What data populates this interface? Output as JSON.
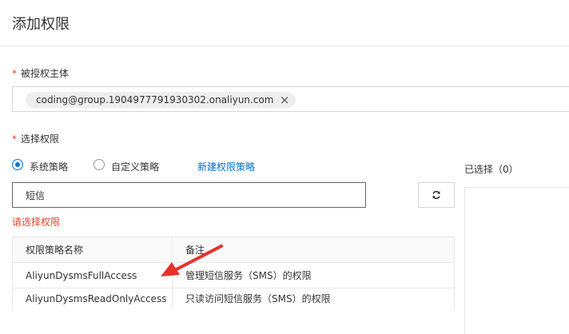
{
  "header": {
    "title": "添加权限"
  },
  "principal": {
    "required_mark": "*",
    "label": "被授权主体",
    "tag_text": "coding@group.1904977791930302.onaliyun.com"
  },
  "permissions": {
    "required_mark": "*",
    "label": "选择权限",
    "radio_system": "系统策略",
    "radio_custom": "自定义策略",
    "selected_radio": "系统策略",
    "new_policy_link": "新建权限策略",
    "search_value": "短信",
    "error": "请选择权限"
  },
  "table": {
    "headers": [
      "权限策略名称",
      "备注"
    ],
    "rows": [
      [
        "AliyunDysmsFullAccess",
        "管理短信服务（SMS）的权限"
      ],
      [
        "AliyunDysmsReadOnlyAccess",
        "只读访问短信服务（SMS）的权限"
      ]
    ]
  },
  "selected": {
    "title": "已选择（0）"
  },
  "colors": {
    "accent": "#0073e6",
    "link": "#0070cc",
    "error": "#e8422d",
    "annotation_arrow": "#e8312a"
  }
}
